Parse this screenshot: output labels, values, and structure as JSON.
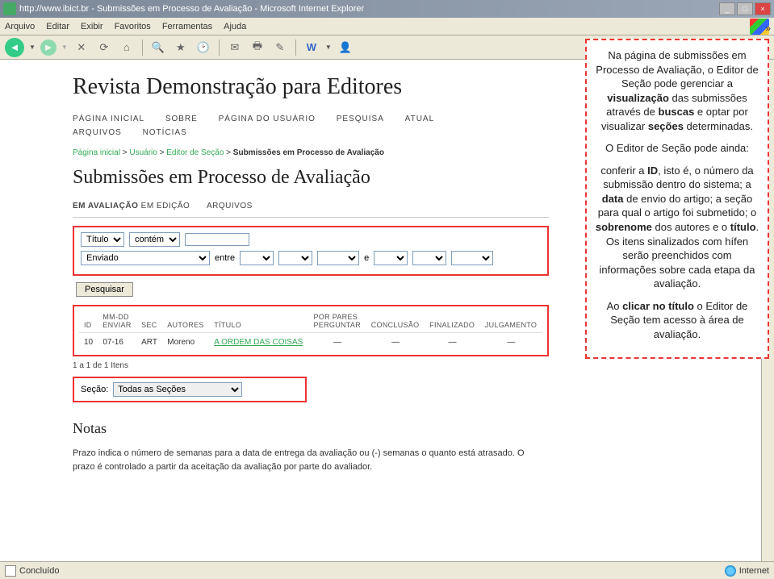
{
  "window": {
    "title": "http://www.ibict.br - Submissões em Processo de Avaliação - Microsoft Internet Explorer"
  },
  "menubar": {
    "arquivo": "Arquivo",
    "editar": "Editar",
    "exibir": "Exibir",
    "favoritos": "Favoritos",
    "ferramentas": "Ferramentas",
    "ajuda": "Ajuda"
  },
  "site": {
    "title": "Revista Demonstração para Editores"
  },
  "nav": {
    "home": "PÁGINA INICIAL",
    "sobre": "SOBRE",
    "usuario": "PÁGINA DO USUÁRIO",
    "pesquisa": "PESQUISA",
    "atual": "ATUAL",
    "arquivos": "ARQUIVOS",
    "noticias": "NOTÍCIAS"
  },
  "breadcrumb": {
    "home": "Página inicial",
    "usuario": "Usuário",
    "editor": "Editor de Seção",
    "current": "Submissões em Processo de Avaliação",
    "sep": ">"
  },
  "page_title": "Submissões em Processo de Avaliação",
  "subtabs": {
    "avaliacao": "EM AVALIAÇÃO",
    "edicao": "EM EDIÇÃO",
    "arquivos": "ARQUIVOS"
  },
  "search": {
    "field": "Título",
    "match": "contém",
    "status": "Enviado",
    "entre": "entre",
    "e": "e",
    "btn": "Pesquisar"
  },
  "table": {
    "headers": {
      "id": "ID",
      "enviar": "MM-DD ENVIAR",
      "sec": "SEC",
      "autores": "AUTORES",
      "titulo": "TÍTULO",
      "pares": "POR PARES PERGUNTAR",
      "conclusao": "CONCLUSÃO",
      "finalizado": "FINALIZADO",
      "julgamento": "JULGAMENTO"
    },
    "rows": [
      {
        "id": "10",
        "enviar": "07-16",
        "sec": "ART",
        "autores": "Moreno",
        "titulo": "A ORDEM DAS COISAS",
        "pares": "—",
        "conclusao": "—",
        "finalizado": "—",
        "julgamento": "—"
      }
    ]
  },
  "pager": "1 a 1 de 1 Itens",
  "section_filter": {
    "label": "Seção:",
    "value": "Todas as Seções"
  },
  "notas": {
    "heading": "Notas",
    "text": "Prazo indica o número de semanas para a data de entrega da avaliação ou (-) semanas o quanto está atrasado. O prazo é controlado a partir da aceitação da avaliação por parte do avaliador."
  },
  "callout": {
    "p1a": "Na página de submissões em Processo de Avaliação, o Editor de Seção pode gerenciar a ",
    "p1b": "visualização",
    "p1c": " das submissões através de ",
    "p1d": "buscas",
    "p1e": " e optar por visualizar ",
    "p1f": "seções",
    "p1g": " determinadas.",
    "p2": "O Editor de Seção pode ainda:",
    "p3a": "conferir a ",
    "p3b": "ID",
    "p3c": ", isto é, o número da submissão dentro do sistema; a ",
    "p3d": "data",
    "p3e": " de envio do artigo; a seção para qual o artigo foi submetido; o ",
    "p3f": "sobrenome",
    "p3g": " dos autores e o ",
    "p3h": "título",
    "p3i": ". Os itens sinalizados com hífen serão preenchidos com informações sobre cada etapa da avaliação.",
    "p4a": "Ao ",
    "p4b": "clicar no título",
    "p4c": " o Editor de Seção tem acesso à área de avaliação."
  },
  "statusbar": {
    "left": "Concluído",
    "right": "Internet"
  },
  "chev": "»"
}
